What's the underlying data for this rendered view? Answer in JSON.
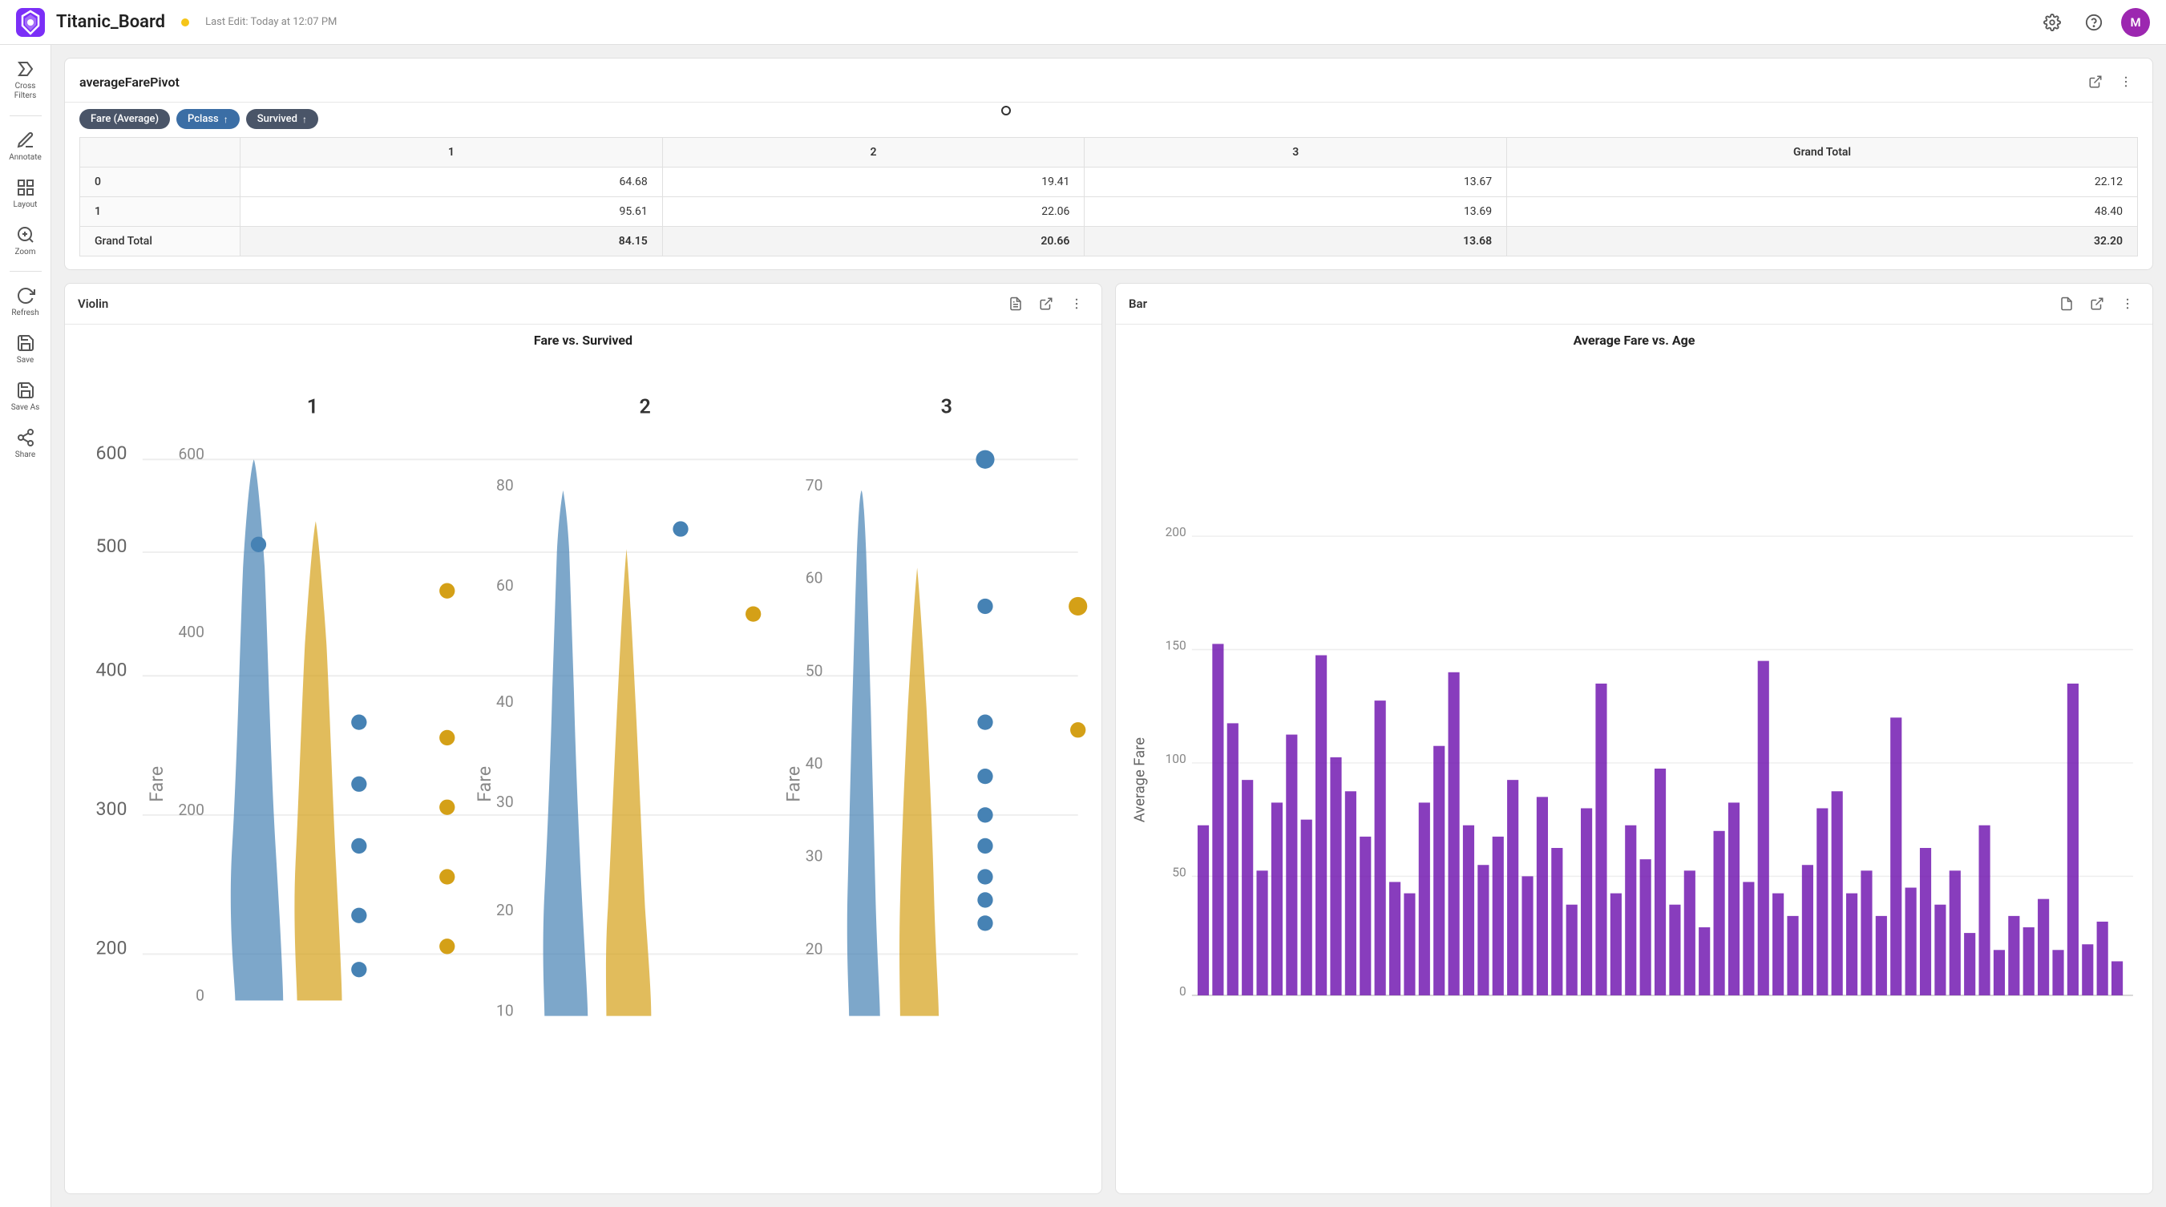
{
  "app": {
    "logo_text": "T",
    "title": "Titanic_Board",
    "last_edit": "Last Edit: Today at 12:07 PM"
  },
  "topbar": {
    "settings_label": "settings",
    "help_label": "help",
    "avatar_label": "M"
  },
  "sidebar": {
    "items": [
      {
        "id": "cross-filters",
        "label": "Cross\nFilters",
        "icon": "⧖"
      },
      {
        "id": "annotate",
        "label": "Annotate",
        "icon": "✏"
      },
      {
        "id": "layout",
        "label": "Layout",
        "icon": "⊞"
      },
      {
        "id": "zoom",
        "label": "Zoom",
        "icon": "⌕"
      },
      {
        "id": "refresh",
        "label": "Refresh",
        "icon": "↺"
      },
      {
        "id": "save",
        "label": "Save",
        "icon": "💾"
      },
      {
        "id": "save-as",
        "label": "Save As",
        "icon": "📋"
      },
      {
        "id": "share",
        "label": "Share",
        "icon": "⤴"
      }
    ]
  },
  "pivot_panel": {
    "title": "averageFarePivot",
    "filter_chips": [
      {
        "id": "fare",
        "label": "Fare (Average)"
      },
      {
        "id": "pclass",
        "label": "Pclass",
        "has_arrow": true
      },
      {
        "id": "survived",
        "label": "Survived",
        "has_arrow": true
      }
    ],
    "table": {
      "column_headers": [
        "",
        "1",
        "2",
        "3",
        "Grand Total"
      ],
      "rows": [
        {
          "label": "0",
          "values": [
            "64.68",
            "19.41",
            "13.67",
            "22.12"
          ]
        },
        {
          "label": "1",
          "values": [
            "95.61",
            "22.06",
            "13.69",
            "48.40"
          ]
        },
        {
          "label": "Grand Total",
          "values": [
            "84.15",
            "20.66",
            "13.68",
            "32.20"
          ],
          "is_total": true
        }
      ]
    }
  },
  "violin_panel": {
    "title": "Violin",
    "chart_title": "Fare vs. Survived",
    "groups": [
      {
        "label": "1",
        "position": 0.16
      },
      {
        "label": "2",
        "position": 0.49
      },
      {
        "label": "3",
        "position": 0.82
      }
    ],
    "y_axis": [
      "600",
      "500",
      "400",
      "300",
      "200"
    ]
  },
  "bar_panel": {
    "title": "Bar",
    "chart_title": "Average Fare vs. Age",
    "y_axis": {
      "label": "Average Fare",
      "ticks": [
        "200",
        "150",
        "100",
        "50",
        "0"
      ]
    }
  }
}
